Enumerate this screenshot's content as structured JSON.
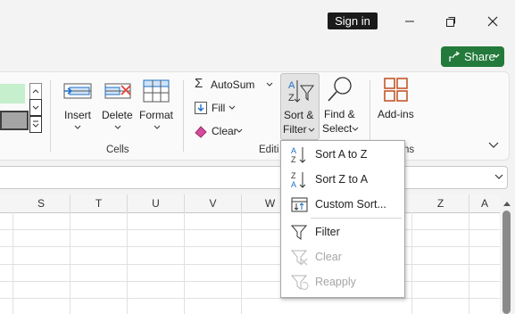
{
  "titlebar": {
    "signin_label": "Sign in"
  },
  "share": {
    "label": "Share"
  },
  "ribbon": {
    "cells": {
      "insert_label": "Insert",
      "delete_label": "Delete",
      "format_label": "Format",
      "group_label": "Cells"
    },
    "editing": {
      "autosum_label": "AutoSum",
      "fill_label": "Fill",
      "clear_label": "Clear",
      "sort_filter_line1": "Sort &",
      "sort_filter_line2": "Filter",
      "find_select_line1": "Find &",
      "find_select_line2": "Select",
      "group_label": "Editi"
    },
    "addins": {
      "label": "Add-ins",
      "group_label_fragment": "ns"
    }
  },
  "grid": {
    "columns": [
      "S",
      "T",
      "U",
      "V",
      "W",
      "Z",
      "A"
    ]
  },
  "sort_menu": {
    "items": [
      {
        "label": "Sort A to Z",
        "enabled": true
      },
      {
        "label": "Sort Z to A",
        "enabled": true
      },
      {
        "label": "Custom Sort...",
        "enabled": true
      },
      {
        "label": "Filter",
        "enabled": true
      },
      {
        "label": "Clear",
        "enabled": false
      },
      {
        "label": "Reapply",
        "enabled": false
      }
    ]
  },
  "colors": {
    "share_green": "#237a3b",
    "accent_blue": "#1f6fc5",
    "sort_filter_pressed": "#e3e3e3"
  }
}
